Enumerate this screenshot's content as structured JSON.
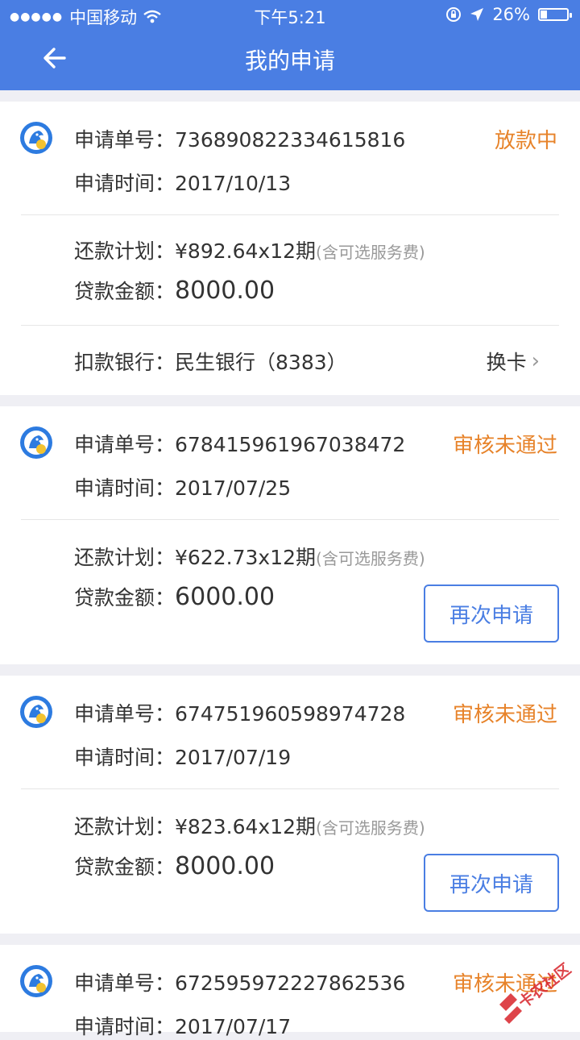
{
  "status_bar": {
    "carrier": "中国移动",
    "time": "下午5:21",
    "battery": "26%",
    "battery_level": 0.26
  },
  "nav": {
    "title": "我的申请"
  },
  "colors": {
    "primary": "#4a7ee3",
    "status": "#e7832a"
  },
  "applications": [
    {
      "no_label": "申请单号：",
      "no": "736890822334615816",
      "time_label": "申请时间：",
      "time": "2017/10/13",
      "status": "放款中",
      "plan_label": "还款计划：",
      "plan": "¥892.64x12期",
      "plan_note": "(含可选服务费)",
      "amount_label": "贷款金额：",
      "amount": "8000.00",
      "bank_label": "扣款银行：",
      "bank": "民生银行（8383）",
      "change_card": "换卡"
    },
    {
      "no_label": "申请单号：",
      "no": "678415961967038472",
      "time_label": "申请时间：",
      "time": "2017/07/25",
      "status": "审核未通过",
      "plan_label": "还款计划：",
      "plan": "¥622.73x12期",
      "plan_note": "(含可选服务费)",
      "amount_label": "贷款金额：",
      "amount": "6000.00",
      "button": "再次申请"
    },
    {
      "no_label": "申请单号：",
      "no": "674751960598974728",
      "time_label": "申请时间：",
      "time": "2017/07/19",
      "status": "审核未通过",
      "plan_label": "还款计划：",
      "plan": "¥823.64x12期",
      "plan_note": "(含可选服务费)",
      "amount_label": "贷款金额：",
      "amount": "8000.00",
      "button": "再次申请"
    },
    {
      "no_label": "申请单号：",
      "no": "672595972227862536",
      "time_label": "申请时间：",
      "time": "2017/07/17",
      "status": "审核未通过"
    }
  ],
  "watermark": "卡农社区"
}
